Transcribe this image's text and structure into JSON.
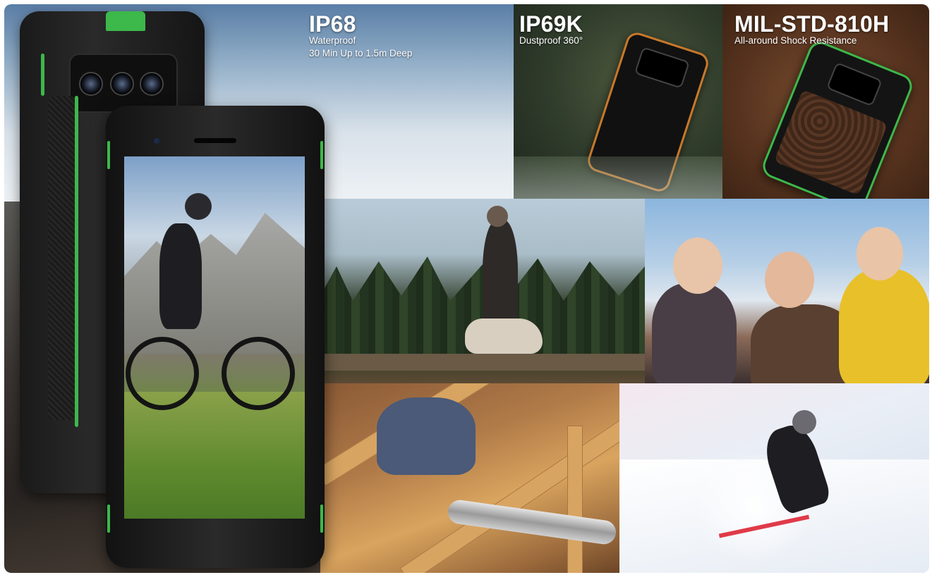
{
  "features": [
    {
      "title": "IP68",
      "lines": [
        "Waterproof",
        "30 Min  Up to 1.5m Deep"
      ]
    },
    {
      "title": "IP69K",
      "lines": [
        "Dustproof 360°"
      ]
    },
    {
      "title": "MIL-STD-810H",
      "lines": [
        "All-around Shock Resistance"
      ]
    }
  ],
  "colors": {
    "accent_green": "#3db84a",
    "phone_body": "#1a1a1a"
  },
  "scenes": [
    "mountain-bike-on-screen",
    "phone-in-water",
    "phone-in-dirt",
    "hiker-with-dog",
    "friends-in-snow",
    "attic-worker",
    "skier"
  ]
}
